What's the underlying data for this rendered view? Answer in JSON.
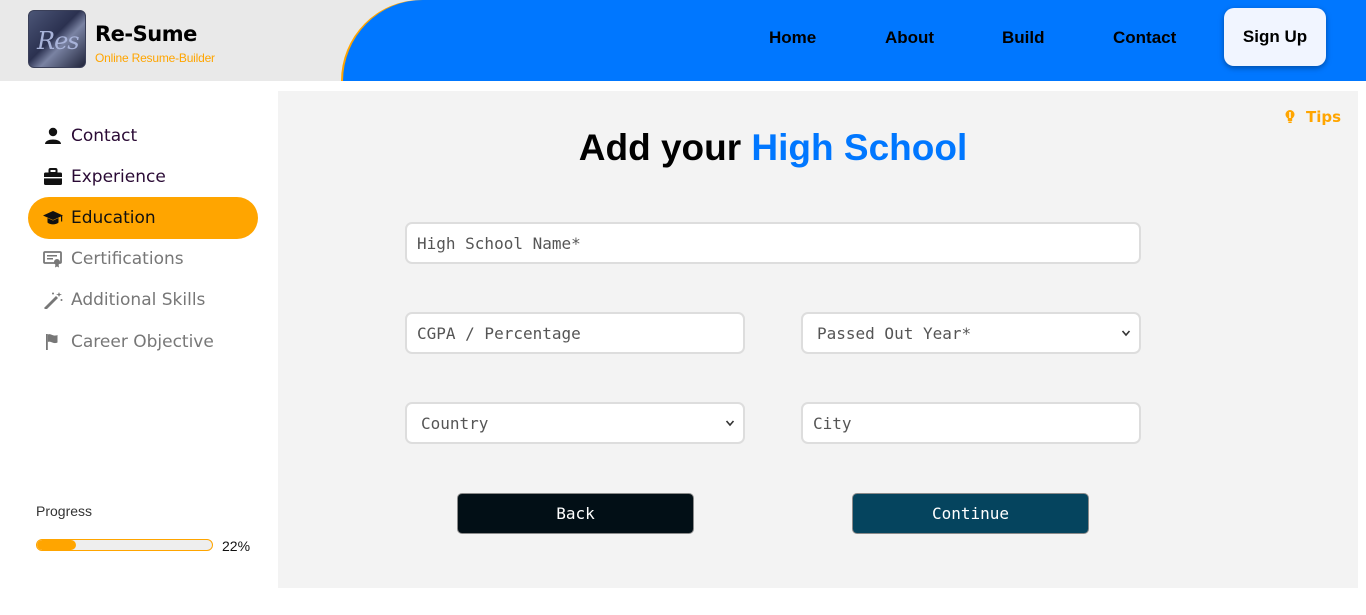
{
  "brand": {
    "name": "Re-Sume",
    "tagline": "Online Resume-Builder",
    "logo_text": "Res"
  },
  "nav": {
    "items": [
      "Home",
      "About",
      "Build",
      "Contact"
    ],
    "signup_label": "Sign Up"
  },
  "sidebar": {
    "items": [
      {
        "label": "Contact",
        "icon": "user-icon",
        "state": "done"
      },
      {
        "label": "Experience",
        "icon": "briefcase-icon",
        "state": "done"
      },
      {
        "label": "Education",
        "icon": "graduation-cap-icon",
        "state": "active"
      },
      {
        "label": "Certifications",
        "icon": "certificate-icon",
        "state": "todo"
      },
      {
        "label": "Additional Skills",
        "icon": "magic-wand-icon",
        "state": "todo"
      },
      {
        "label": "Career Objective",
        "icon": "flag-icon",
        "state": "todo"
      }
    ],
    "progress": {
      "label": "Progress",
      "value": 22,
      "text": "22%"
    }
  },
  "main": {
    "tips_label": "Tips",
    "title_prefix": "Add your ",
    "title_highlight": "High School",
    "fields": {
      "school_name_placeholder": "High School Name*",
      "cgpa_placeholder": "CGPA / Percentage",
      "passed_out_year": "Passed Out Year*",
      "country": "Country",
      "city_placeholder": "City"
    },
    "buttons": {
      "back": "Back",
      "continue": "Continue"
    }
  },
  "colors": {
    "accent_blue": "#0077ff",
    "accent_orange": "#ffa500",
    "back_button": "#020f16",
    "continue_button": "#05445e"
  }
}
